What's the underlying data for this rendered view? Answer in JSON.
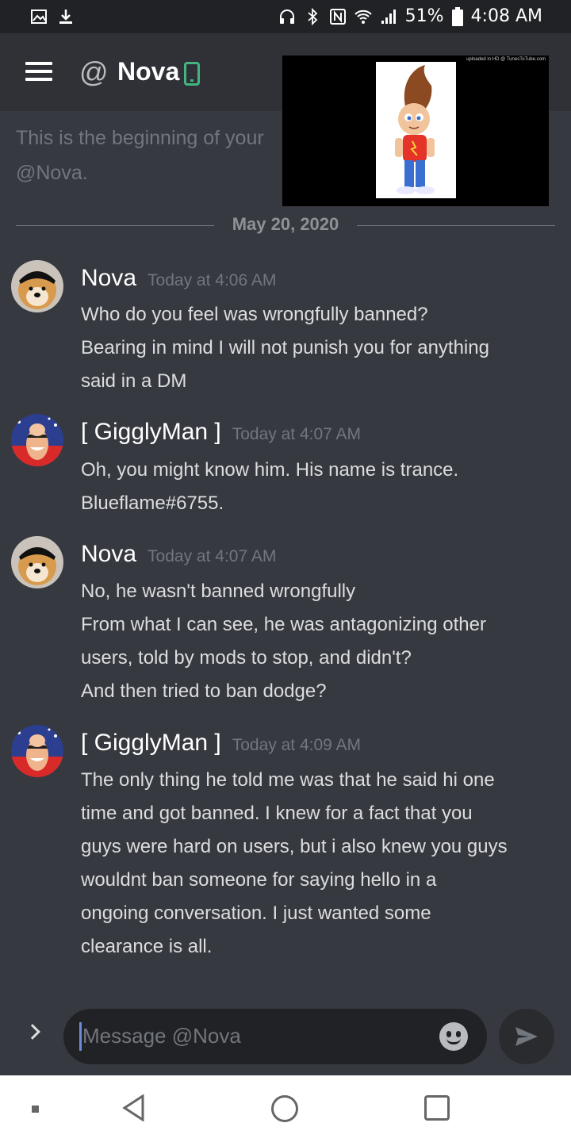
{
  "status_bar": {
    "battery": "51%",
    "time": "4:08 AM",
    "icons": [
      "image-icon",
      "download-icon",
      "headphones-icon",
      "bluetooth-icon",
      "nfc-icon",
      "wifi-icon",
      "signal-icon",
      "battery-icon"
    ]
  },
  "header": {
    "at_symbol": "@",
    "channel_name": "Nova",
    "status_icon": "mobile-online-icon",
    "menu_icon": "hamburger-icon"
  },
  "video_overlay": {
    "watermark": "uploaded in HD @ TunesToTube.com"
  },
  "intro": {
    "line1": "This is the beginning of your",
    "line2": "@Nova."
  },
  "date_divider": "May 20, 2020",
  "messages": [
    {
      "author": "Nova",
      "timestamp": "Today at 4:06 AM",
      "lines": [
        "Who do you feel was wrongfully banned?",
        "Bearing in mind I will not punish you for anything",
        "said in a DM"
      ]
    },
    {
      "author": "[ GigglyMan ]",
      "timestamp": "Today at 4:07 AM",
      "lines": [
        "Oh, you might know him. His name is trance.",
        "Blueflame#6755."
      ]
    },
    {
      "author": "Nova",
      "timestamp": "Today at 4:07 AM",
      "lines": [
        "No, he wasn't banned wrongfully",
        "From what I can see, he was antagonizing other",
        "users, told by mods to stop, and didn't?",
        "And then tried to ban dodge?"
      ]
    },
    {
      "author": "[ GigglyMan ]",
      "timestamp": "Today at 4:09 AM",
      "lines": [
        "The only thing he told me was that he said hi one",
        "time and got banned. I knew for a fact that you",
        "guys were hard on users, but i also knew you guys",
        "wouldnt ban someone for saying hello in a",
        "ongoing conversation. I just wanted some",
        "clearance is all."
      ]
    }
  ],
  "composer": {
    "placeholder": "Message @Nova",
    "value": ""
  },
  "colors": {
    "background": "#36393f",
    "header": "#2f3136",
    "status_bar": "#202225",
    "online_green": "#43b581",
    "caret": "#7289da"
  }
}
